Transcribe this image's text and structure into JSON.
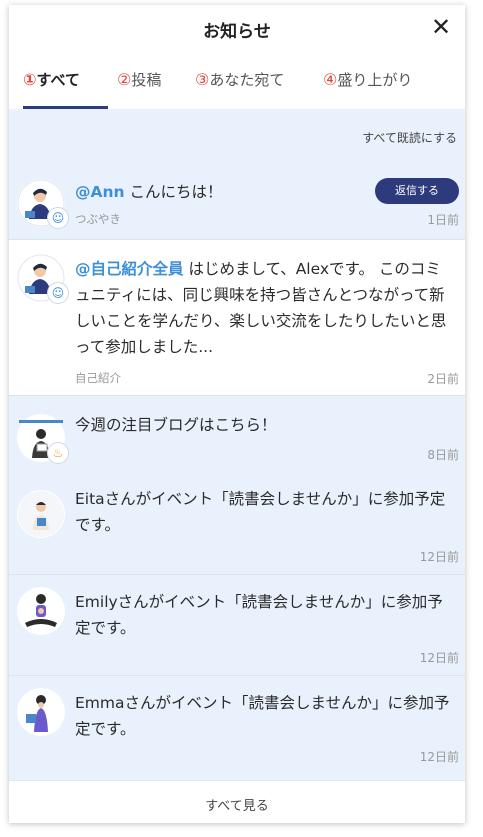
{
  "header": {
    "title": "お知らせ",
    "close_glyph": "✕"
  },
  "tabs": [
    {
      "num": "①",
      "label": "すべて",
      "active": true
    },
    {
      "num": "②",
      "label": "投稿",
      "active": false
    },
    {
      "num": "③",
      "label": "あなた宛て",
      "active": false
    },
    {
      "num": "④",
      "label": "盛り上がり",
      "active": false
    }
  ],
  "mark_all_read": "すべて既読にする",
  "notifications": [
    {
      "mention": "@Ann",
      "text": " こんにちは！",
      "category": "つぶやき",
      "time": "1日前",
      "reply_label": "返信する",
      "badge_icon": "smiley-icon",
      "read": false
    },
    {
      "mention": "@自己紹介全員",
      "text": " はじめまして、Alexです。 このコミュニティには、同じ興味を持つ皆さんとつながって新しいことを学んだり、楽しい交流をしたりしたいと思って参加しました...",
      "category": "自己紹介",
      "time": "2日前",
      "badge_icon": "smiley-icon",
      "read": true
    },
    {
      "text": "今週の注目ブログはこちら！",
      "time": "8日前",
      "badge_icon": "fire-icon",
      "read": false
    },
    {
      "text": "Eitaさんがイベント「読書会しませんか」に参加予定です。",
      "time": "12日前",
      "read": false
    },
    {
      "text": "Emilyさんがイベント「読書会しませんか」に参加予定です。",
      "time": "12日前",
      "read": false
    },
    {
      "text": "Emmaさんがイベント「読書会しませんか」に参加予定です。",
      "time": "12日前",
      "read": false
    }
  ],
  "footer": {
    "see_all": "すべて見る"
  },
  "colors": {
    "accent": "#2d3a7c",
    "mention": "#3d8fd8",
    "unread_bg": "#e8f1fc",
    "tab_number": "#e0483c"
  }
}
